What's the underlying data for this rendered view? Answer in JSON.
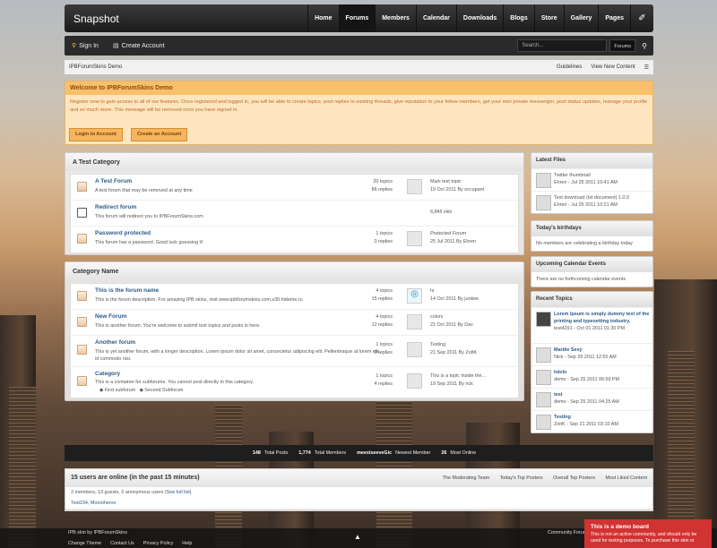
{
  "nav": {
    "logo": "Snapshot",
    "items": [
      "Home",
      "Forums",
      "Members",
      "Calendar",
      "Downloads",
      "Blogs",
      "Store",
      "Gallery",
      "Pages"
    ],
    "active": "Forums"
  },
  "userbar": {
    "sign_in": "Sign In",
    "create_account": "Create Account",
    "search_placeholder": "Search...",
    "search_scope": "Forums"
  },
  "breadcrumb": {
    "home": "IPBForumSkins Demo",
    "guidelines": "Guidelines",
    "view_new": "View New Content"
  },
  "welcome": {
    "title": "Welcome to IPBForumSkins Demo",
    "body": "Register now to gain access to all of our features. Once registered and logged in, you will be able to create topics, post replies to existing threads, give reputation to your fellow members, get your own private messenger, post status updates, manage your profile and so much more. This message will be removed once you have signed in.",
    "login_btn": "Login to Account",
    "create_btn": "Create an Account"
  },
  "categories": [
    {
      "title": "A Test Category",
      "forums": [
        {
          "title": "A Test Forum",
          "desc": "A test forum that may be removed at any time",
          "stats": [
            "20 topics",
            "86 replies"
          ],
          "last": [
            "Main test topic",
            "19 Oct 2011 By occupant"
          ]
        },
        {
          "title": "Redirect forum",
          "desc": "This forum will redirect you to IPBForumSkins.com",
          "stats": [],
          "last": [
            "6,845 Hits"
          ]
        },
        {
          "title": "Password protected",
          "desc": "This forum has a password. Good luck guessing it!",
          "stats": [
            "1 topics",
            "0 replies"
          ],
          "last": [
            "Protected Forum",
            "25 Jul 2011 By Ehren"
          ]
        }
      ]
    },
    {
      "title": "Category Name",
      "forums": [
        {
          "title": "This is the forum name",
          "desc": "This is the forum description. For amazing IPB skins, visit www.ipbforumskins.com.s30.hideme.ru",
          "stats": [
            "4 topics",
            "15 replies"
          ],
          "last": [
            "hi",
            "14 Oct 2011 By junkee"
          ]
        },
        {
          "title": "New Forum",
          "desc": "This is another forum. You're welcome to submit test topics and posts in here.",
          "stats": [
            "4 topics",
            "12 replies"
          ],
          "last": [
            "colors",
            "21 Oct 2011 By Dav"
          ]
        },
        {
          "title": "Another forum",
          "desc": "This is yet another forum, with a longer description. Lorem ipsum dolor sit amet, consectetur adipiscing elit. Pellentesque at lorem elit, id commodo nisi.",
          "stats": [
            "1 topics",
            "0 replies"
          ],
          "last": [
            "Testing",
            "21 Sep 2011 By ZoltK"
          ]
        },
        {
          "title": "Category",
          "desc": "This is a container for subforums. You cannot post directly in this category.",
          "stats": [
            "1 topics",
            "4 replies"
          ],
          "last": [
            "This is a topic inside the...",
            "19 Sep 2011 By rick"
          ],
          "subforums": [
            "First subforum",
            "Second Subforum"
          ]
        }
      ]
    }
  ],
  "sidebar": {
    "latest_files": {
      "title": "Latest Files",
      "items": [
        {
          "name": "Twitter thumbnail",
          "meta": "Ehren - Jul 25 2011 10:41 AM"
        },
        {
          "name": "Test download (txt document) 1.0.0",
          "meta": "Ehren - Jul 25 2011 10:21 AM"
        }
      ]
    },
    "birthdays": {
      "title": "Today's birthdays",
      "text": "No members are celebrating a birthday today"
    },
    "calendar": {
      "title": "Upcoming Calendar Events",
      "text": "There are no forthcoming calendar events"
    },
    "recent": {
      "title": "Recent Topics",
      "items": [
        {
          "name": "Lorem Ipsum is simply dummy text of the printing and typesetting industry.",
          "meta": "test4291 - Oct 01 2011 01:30 PM"
        },
        {
          "name": "Marble Sexy",
          "meta": "Nick - Sep 26 2011 12:55 AM"
        },
        {
          "name": "lololo",
          "meta": "demo - Sep 25 2011 06:59 PM"
        },
        {
          "name": "test",
          "meta": "demo - Sep 25 2011 04:25 AM"
        },
        {
          "name": "Testing",
          "meta": "ZoltK - Sep 21 2011 03:10 AM"
        }
      ]
    }
  },
  "stats": {
    "posts": "148",
    "posts_label": "Total Posts",
    "members": "1,774",
    "members_label": "Total Members",
    "newest": "meexiseeveGic",
    "newest_label": "Newest Member",
    "most": "26",
    "most_label": "Most Online"
  },
  "online": {
    "title": "15 users are online (in the past 15 minutes)",
    "tabs": [
      "The Moderating Team",
      "Today's Top Posters",
      "Overall Top Posters",
      "Most Liked Content"
    ],
    "summary": "2 members, 13 guests, 0 anonymous users",
    "full_list": "(See full list)",
    "members": "Test234, Monotherve"
  },
  "footer": {
    "credit": "IPB skin by IPBForumSkins",
    "links": [
      "Change Theme",
      "Contact Us",
      "Privacy Policy",
      "Help"
    ],
    "right": "Community Forum"
  },
  "demo": {
    "title": "This is a demo board",
    "text": "This is not an active community, and should only be used for testing purposes. To purchase this skin or"
  }
}
